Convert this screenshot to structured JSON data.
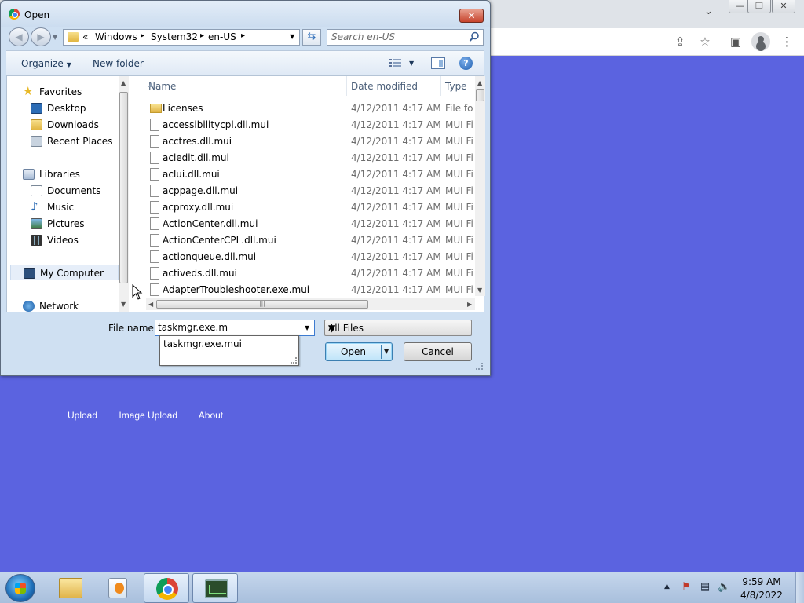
{
  "dialog": {
    "title": "Open",
    "close_glyph": "✕",
    "nav_back_glyph": "◀",
    "nav_forward_glyph": "▶",
    "address": {
      "overflow": "«",
      "crumbs": [
        "Windows",
        "System32",
        "en-US"
      ],
      "sep": "▸"
    },
    "refresh_glyph": "⇆",
    "search_placeholder": "Search en-US",
    "toolbar": {
      "organize": "Organize",
      "new_folder": "New folder",
      "help_glyph": "?"
    },
    "nav_pane": {
      "items": [
        {
          "label": "Favorites",
          "icon": "star-icon"
        },
        {
          "label": "Desktop",
          "icon": "desktop-icon"
        },
        {
          "label": "Downloads",
          "icon": "downloads-icon"
        },
        {
          "label": "Recent Places",
          "icon": "recent-places-icon"
        },
        {
          "label": "Libraries",
          "icon": "libraries-icon"
        },
        {
          "label": "Documents",
          "icon": "documents-icon"
        },
        {
          "label": "Music",
          "icon": "music-icon"
        },
        {
          "label": "Pictures",
          "icon": "pictures-icon"
        },
        {
          "label": "Videos",
          "icon": "videos-icon"
        },
        {
          "label": "My Computer",
          "icon": "computer-icon"
        },
        {
          "label": "Network",
          "icon": "network-icon"
        }
      ]
    },
    "columns": {
      "name": "Name",
      "date": "Date modified",
      "type": "Type"
    },
    "files": [
      {
        "name": "Licenses",
        "date": "4/12/2011 4:17 AM",
        "type": "File fol",
        "folder": true
      },
      {
        "name": "accessibilitycpl.dll.mui",
        "date": "4/12/2011 4:17 AM",
        "type": "MUI Fi"
      },
      {
        "name": "acctres.dll.mui",
        "date": "4/12/2011 4:17 AM",
        "type": "MUI Fi"
      },
      {
        "name": "acledit.dll.mui",
        "date": "4/12/2011 4:17 AM",
        "type": "MUI Fi"
      },
      {
        "name": "aclui.dll.mui",
        "date": "4/12/2011 4:17 AM",
        "type": "MUI Fi"
      },
      {
        "name": "acppage.dll.mui",
        "date": "4/12/2011 4:17 AM",
        "type": "MUI Fi"
      },
      {
        "name": "acproxy.dll.mui",
        "date": "4/12/2011 4:17 AM",
        "type": "MUI Fi"
      },
      {
        "name": "ActionCenter.dll.mui",
        "date": "4/12/2011 4:17 AM",
        "type": "MUI Fi"
      },
      {
        "name": "ActionCenterCPL.dll.mui",
        "date": "4/12/2011 4:17 AM",
        "type": "MUI Fi"
      },
      {
        "name": "actionqueue.dll.mui",
        "date": "4/12/2011 4:17 AM",
        "type": "MUI Fi"
      },
      {
        "name": "activeds.dll.mui",
        "date": "4/12/2011 4:17 AM",
        "type": "MUI Fi"
      },
      {
        "name": "AdapterTroubleshooter.exe.mui",
        "date": "4/12/2011 4:17 AM",
        "type": "MUI Fi"
      }
    ],
    "file_name_label": "File name:",
    "file_name_value": "taskmgr.exe.m",
    "autocomplete": "taskmgr.exe.mui",
    "file_type": "All Files",
    "open": "Open",
    "cancel": "Cancel"
  },
  "page": {
    "links": [
      "Upload",
      "Image Upload",
      "About"
    ]
  },
  "browser": {
    "minimize_glyph": "—",
    "restore_glyph": "❐",
    "close_glyph": "✕"
  },
  "taskbar": {
    "time": "9:59 AM",
    "date": "4/8/2022",
    "apps": [
      "explorer-icon",
      "media-player-icon",
      "chrome-icon",
      "system-monitor-icon"
    ]
  }
}
